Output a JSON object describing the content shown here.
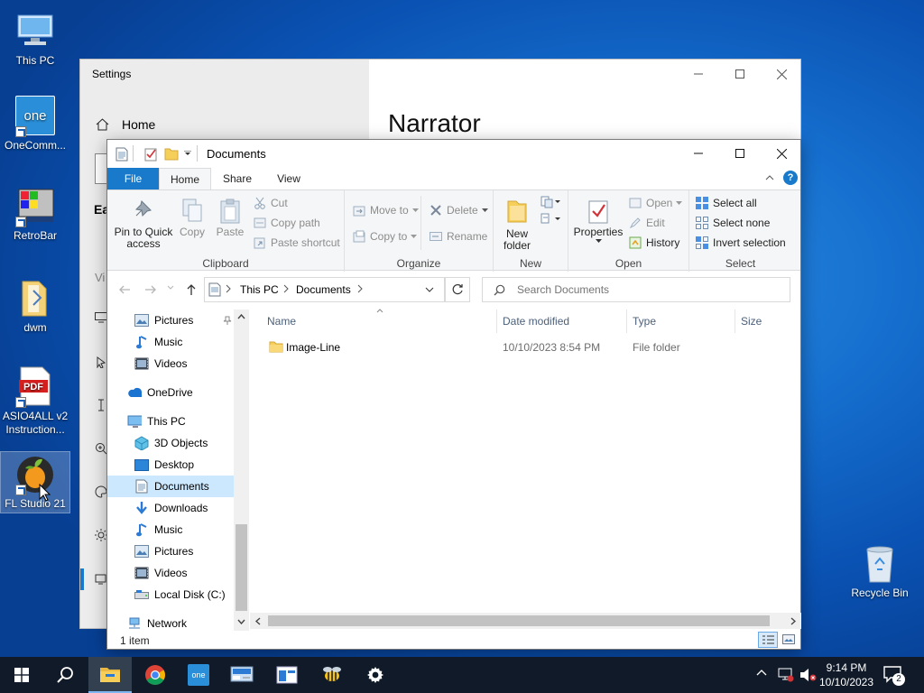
{
  "desktop": {
    "icons": [
      {
        "label": "This PC",
        "icon": "this-pc-icon"
      },
      {
        "label": "OneComm...",
        "icon": "onecommander-icon"
      },
      {
        "label": "RetroBar",
        "icon": "retrobar-icon"
      },
      {
        "label": "dwm",
        "icon": "folder-icon"
      },
      {
        "label": "ASIO4ALL v2 Instruction...",
        "icon": "pdf-icon"
      },
      {
        "label": "FL Studio 21",
        "icon": "fl-studio-icon"
      },
      {
        "label": "Recycle Bin",
        "icon": "recycle-bin-icon"
      }
    ]
  },
  "settings": {
    "title": "Settings",
    "home": "Home",
    "heading": "Narrator",
    "partial_text": "Ea",
    "partial_vi": "Vi"
  },
  "explorer": {
    "title": "Documents",
    "tabs": {
      "file": "File",
      "home": "Home",
      "share": "Share",
      "view": "View"
    },
    "ribbon": {
      "clipboard": {
        "label": "Clipboard",
        "pin": "Pin to Quick access",
        "copy": "Copy",
        "paste": "Paste",
        "cut": "Cut",
        "copy_path": "Copy path",
        "paste_shortcut": "Paste shortcut"
      },
      "organize": {
        "label": "Organize",
        "move_to": "Move to",
        "copy_to": "Copy to",
        "delete": "Delete",
        "rename": "Rename"
      },
      "new": {
        "label": "New",
        "new_folder": "New folder"
      },
      "open": {
        "label": "Open",
        "properties": "Properties",
        "open": "Open",
        "edit": "Edit",
        "history": "History"
      },
      "select": {
        "label": "Select",
        "select_all": "Select all",
        "select_none": "Select none",
        "invert": "Invert selection"
      }
    },
    "address": {
      "root": "This PC",
      "current": "Documents"
    },
    "search": {
      "placeholder": "Search Documents"
    },
    "nav": {
      "quick": [
        {
          "label": "Pictures",
          "icon": "pictures-icon"
        },
        {
          "label": "Music",
          "icon": "music-icon"
        },
        {
          "label": "Videos",
          "icon": "videos-icon"
        }
      ],
      "onedrive": "OneDrive",
      "this_pc": "This PC",
      "pc_items": [
        {
          "label": "3D Objects",
          "icon": "3d-objects-icon"
        },
        {
          "label": "Desktop",
          "icon": "desktop-icon"
        },
        {
          "label": "Documents",
          "icon": "documents-icon"
        },
        {
          "label": "Downloads",
          "icon": "downloads-icon"
        },
        {
          "label": "Music",
          "icon": "music-icon"
        },
        {
          "label": "Pictures",
          "icon": "pictures-icon"
        },
        {
          "label": "Videos",
          "icon": "videos-icon"
        },
        {
          "label": "Local Disk (C:)",
          "icon": "local-disk-icon"
        }
      ],
      "network": "Network"
    },
    "columns": {
      "name": "Name",
      "date": "Date modified",
      "type": "Type",
      "size": "Size"
    },
    "files": [
      {
        "name": "Image-Line",
        "date": "10/10/2023 8:54 PM",
        "type": "File folder",
        "size": ""
      }
    ],
    "status": "1 item"
  },
  "taskbar": {
    "time": "9:14 PM",
    "date": "10/10/2023",
    "notification_count": "2",
    "one_label": "one"
  },
  "colors": {
    "accent": "#1979ca",
    "file_tab": "#1979ca",
    "folder": "#f6cf5b",
    "selection": "#cce8ff"
  }
}
